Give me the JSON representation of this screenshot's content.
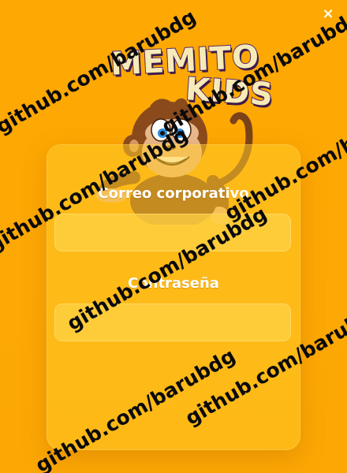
{
  "window": {
    "close_symbol": "×",
    "close_icon": "close-icon"
  },
  "logo": {
    "main_text": "MEMITO",
    "sub_text": "KIDS",
    "mascot": "monkey-mascot-icon"
  },
  "form": {
    "email_label": "Correo corporativo",
    "email_value": "",
    "password_label": "Contraseña",
    "password_value": ""
  },
  "watermark": {
    "text": "github.com/barubdg"
  },
  "colors": {
    "background": "#fda603",
    "card": "#ffc828",
    "input": "#ffd246",
    "label_text": "#ffffff",
    "logo_fill": "#f6ebb8",
    "logo_outline": "#5c2a66"
  }
}
